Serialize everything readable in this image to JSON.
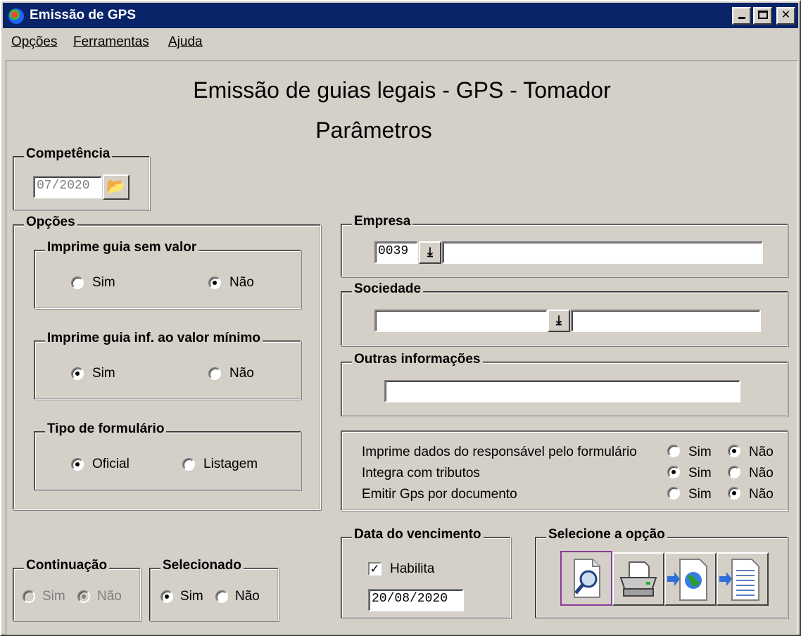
{
  "window": {
    "title": "Emissão de GPS"
  },
  "menu": [
    "Opções",
    "Ferramentas",
    "Ajuda"
  ],
  "header": {
    "title": "Emissão de guias legais - GPS - Tomador",
    "subtitle": "Parâmetros"
  },
  "competencia": {
    "legend": "Competência",
    "value": "07/2020"
  },
  "opcoes": {
    "legend": "Opções",
    "guia_sem_valor": {
      "legend": "Imprime guia sem valor",
      "sim": "Sim",
      "nao": "Não",
      "selected": "nao"
    },
    "guia_inf_minimo": {
      "legend": "Imprime guia inf. ao valor mínimo",
      "sim": "Sim",
      "nao": "Não",
      "selected": "sim"
    },
    "tipo_formulario": {
      "legend": "Tipo de formulário",
      "oficial": "Oficial",
      "listagem": "Listagem",
      "selected": "oficial"
    }
  },
  "empresa": {
    "legend": "Empresa",
    "code": "0039",
    "name": ""
  },
  "sociedade": {
    "legend": "Sociedade",
    "code": "",
    "name": ""
  },
  "outras": {
    "legend": "Outras informações",
    "value": ""
  },
  "flags": [
    {
      "label": "Imprime dados do responsável pelo formulário",
      "sim": "Sim",
      "nao": "Não",
      "selected": "nao"
    },
    {
      "label": "Integra com tributos",
      "sim": "Sim",
      "nao": "Não",
      "selected": "sim"
    },
    {
      "label": "Emitir Gps por documento",
      "sim": "Sim",
      "nao": "Não",
      "selected": "nao"
    }
  ],
  "vencimento": {
    "legend": "Data do vencimento",
    "habilita_label": "Habilita",
    "habilita": true,
    "date": "20/08/2020"
  },
  "selecione": {
    "legend": "Selecione a opção",
    "icons": [
      "preview-icon",
      "printer-icon",
      "export-web-icon",
      "export-doc-icon"
    ]
  },
  "continuacao": {
    "legend": "Continuação",
    "sim": "Sim",
    "nao": "Não",
    "selected": "nao"
  },
  "selecionado": {
    "legend": "Selecionado",
    "sim": "Sim",
    "nao": "Não",
    "selected": "sim"
  }
}
